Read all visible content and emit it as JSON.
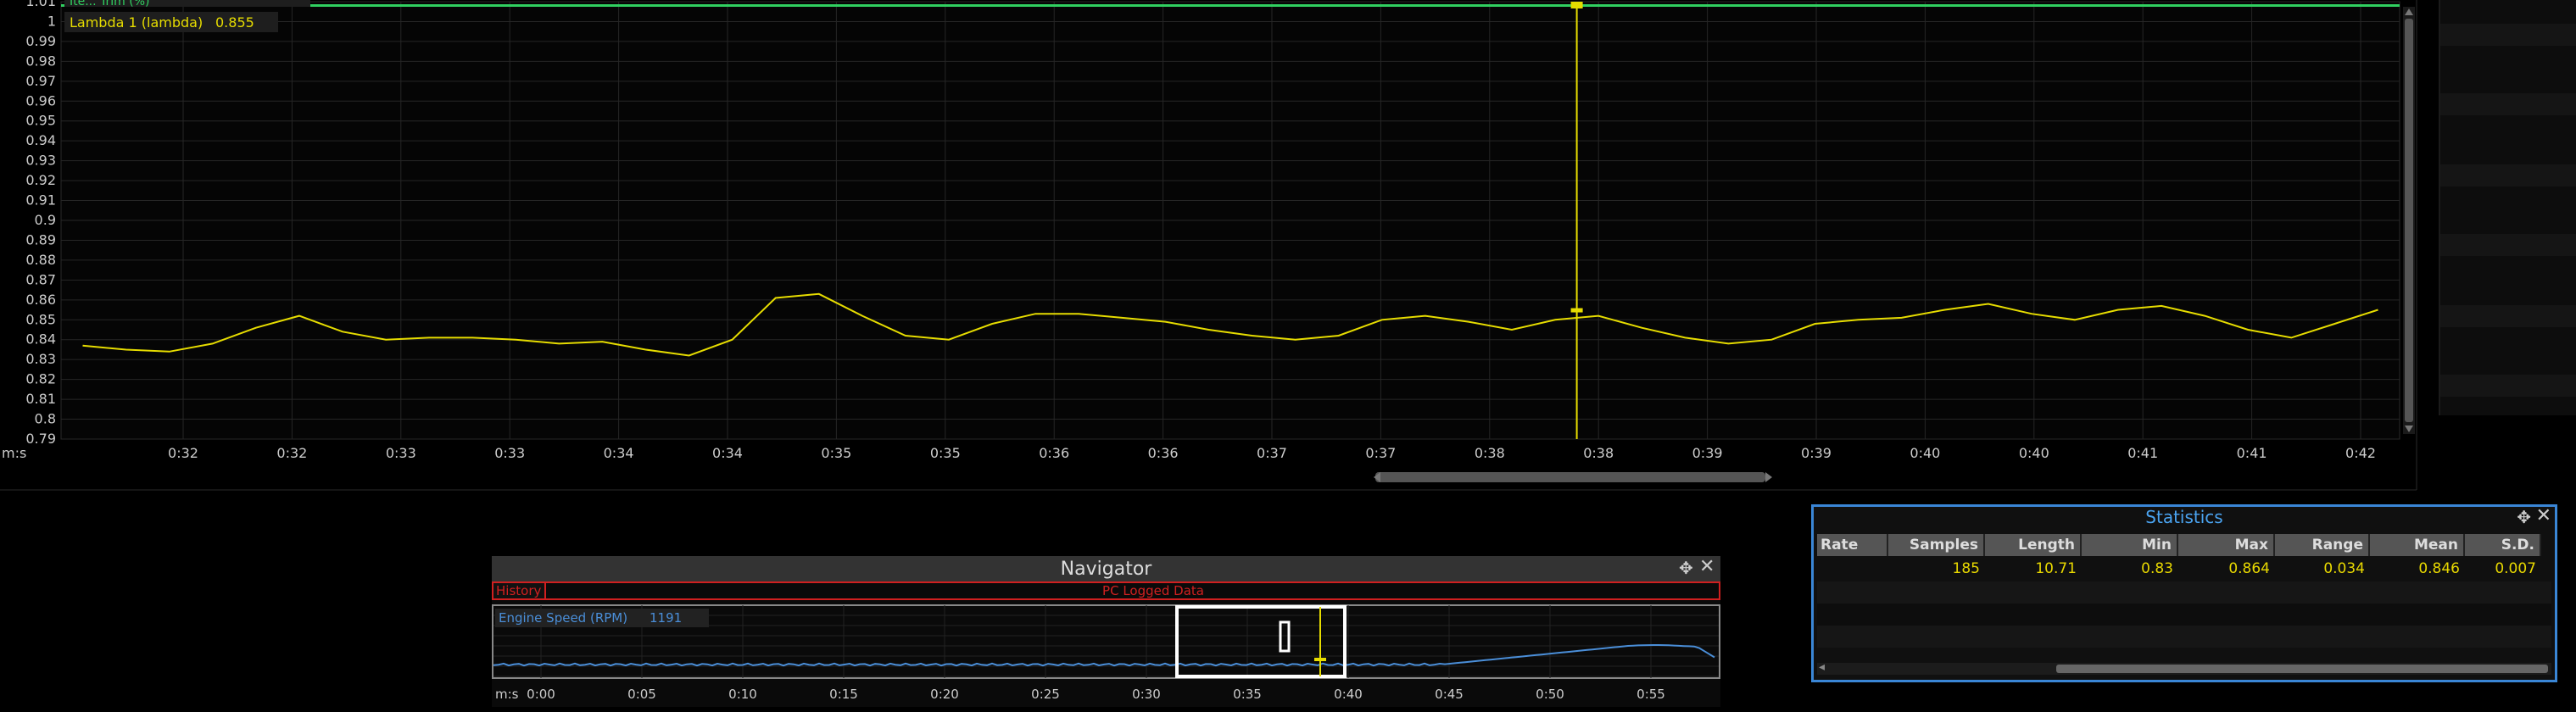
{
  "chart": {
    "legend_top": "Ite... Trim (%)",
    "legend_lambda_label": "Lambda 1 (lambda)",
    "legend_lambda_value": "0.855",
    "time_unit": "m:s",
    "x_ticks": [
      "0:32",
      "0:32",
      "0:33",
      "0:33",
      "0:34",
      "0:34",
      "0:35",
      "0:35",
      "0:36",
      "0:36",
      "0:37",
      "0:37",
      "0:38",
      "0:38",
      "0:39",
      "0:39",
      "0:40",
      "0:40",
      "0:41",
      "0:41",
      "0:42"
    ],
    "y_ticks": [
      "1.01",
      "1",
      "0.99",
      "0.98",
      "0.97",
      "0.96",
      "0.95",
      "0.94",
      "0.93",
      "0.92",
      "0.91",
      "0.9",
      "0.89",
      "0.88",
      "0.87",
      "0.86",
      "0.85",
      "0.84",
      "0.83",
      "0.82",
      "0.81",
      "0.8",
      "0.79"
    ],
    "colors": {
      "lambda": "#e6dc00",
      "top_trace": "#30d060",
      "grid": "#2a2a2a"
    }
  },
  "chart_data": {
    "type": "line",
    "title": "",
    "xlabel": "m:s",
    "ylabel": "",
    "ylim": [
      0.79,
      1.01
    ],
    "series": [
      {
        "name": "Lambda 1 (lambda)",
        "x": [
          31.5,
          31.7,
          31.9,
          32.1,
          32.3,
          32.5,
          32.7,
          32.9,
          33.1,
          33.3,
          33.5,
          33.7,
          33.9,
          34.1,
          34.3,
          34.5,
          34.7,
          34.9,
          35.1,
          35.3,
          35.5,
          35.7,
          35.9,
          36.1,
          36.3,
          36.5,
          36.7,
          36.9,
          37.1,
          37.3,
          37.5,
          37.7,
          37.9,
          38.1,
          38.3,
          38.5,
          38.7,
          38.9,
          39.1,
          39.3,
          39.5,
          39.7,
          39.9,
          40.1,
          40.3,
          40.5,
          40.7,
          40.9,
          41.1,
          41.3,
          41.5,
          41.7,
          41.9,
          42.1
        ],
        "values": [
          0.837,
          0.835,
          0.834,
          0.838,
          0.846,
          0.852,
          0.844,
          0.84,
          0.841,
          0.841,
          0.84,
          0.838,
          0.839,
          0.835,
          0.832,
          0.84,
          0.861,
          0.863,
          0.852,
          0.842,
          0.84,
          0.848,
          0.853,
          0.853,
          0.851,
          0.849,
          0.845,
          0.842,
          0.84,
          0.842,
          0.85,
          0.852,
          0.849,
          0.845,
          0.85,
          0.852,
          0.846,
          0.841,
          0.838,
          0.84,
          0.848,
          0.85,
          0.851,
          0.855,
          0.858,
          0.853,
          0.85,
          0.855,
          0.857,
          0.852,
          0.845,
          0.841,
          0.848,
          0.855
        ]
      }
    ],
    "cursor_x": 38.4,
    "cursor_value": 0.855
  },
  "navigator": {
    "title": "Navigator",
    "history_label": "History",
    "source_label": "PC Logged Data",
    "channel_label": "Engine Speed (RPM)",
    "channel_value": "1191",
    "time_unit": "m:s",
    "x_ticks": [
      "0:00",
      "0:05",
      "0:10",
      "0:15",
      "0:20",
      "0:25",
      "0:30",
      "0:35",
      "0:40",
      "0:45",
      "0:50",
      "0:55"
    ],
    "colors": {
      "rpm": "#4a8ed8",
      "accent": "#d02020"
    }
  },
  "statistics": {
    "title": "Statistics",
    "columns": [
      "Rate",
      "Samples",
      "Length",
      "Min",
      "Max",
      "Range",
      "Mean",
      "S.D."
    ],
    "row": [
      "",
      "185",
      "10.71",
      "0.83",
      "0.864",
      "0.034",
      "0.846",
      "0.007"
    ]
  }
}
